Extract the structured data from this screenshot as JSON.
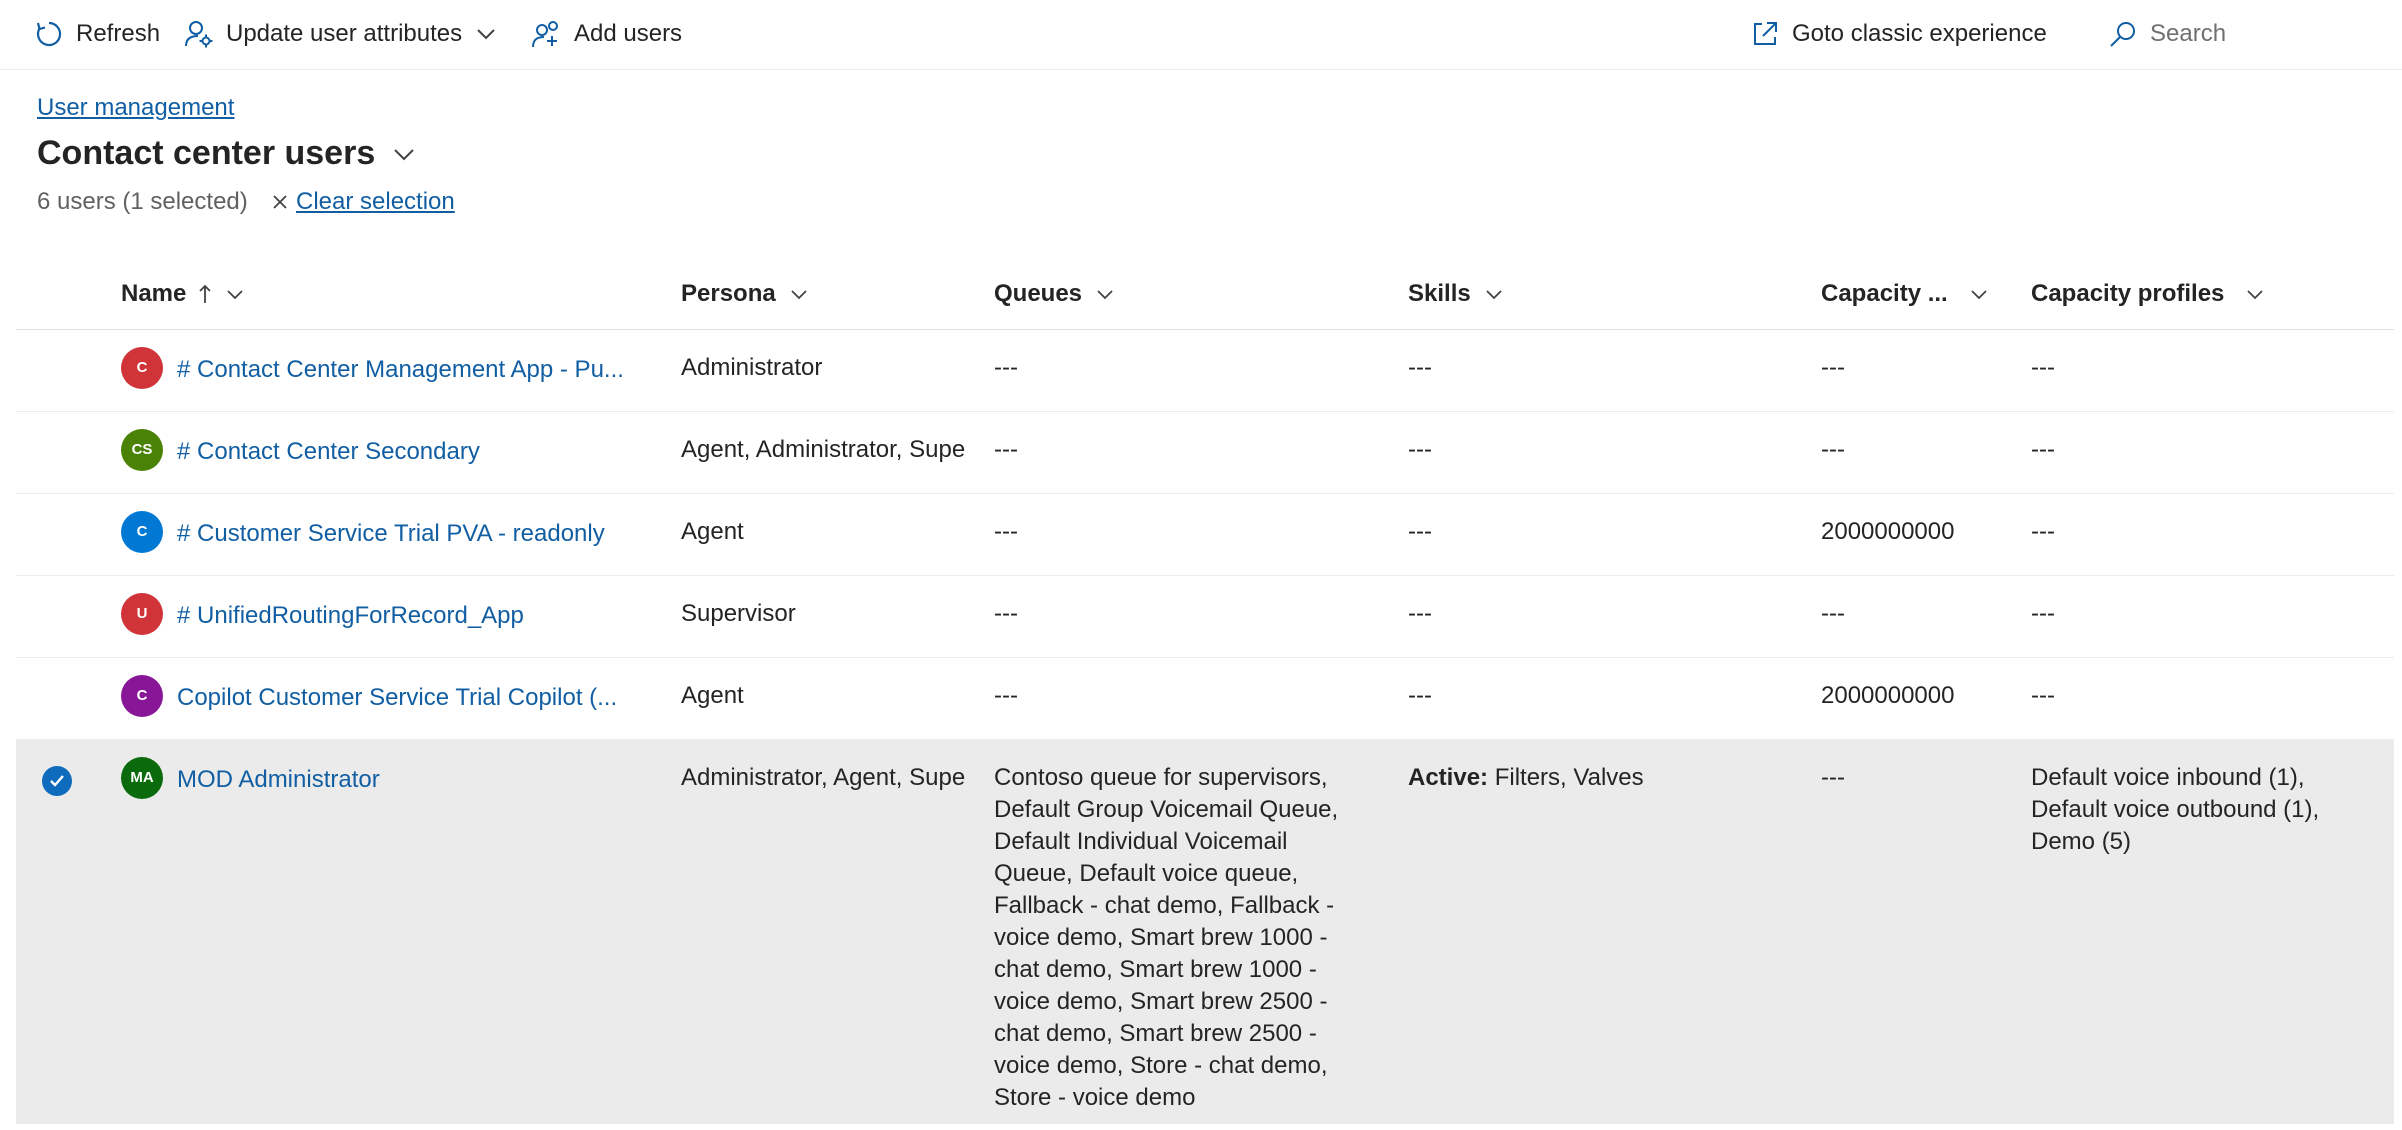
{
  "toolbar": {
    "refresh": "Refresh",
    "update_user_attributes": "Update user attributes",
    "add_users": "Add users",
    "goto_classic": "Goto classic experience",
    "search_placeholder": "Search"
  },
  "header": {
    "breadcrumb": "User management",
    "title": "Contact center users",
    "selection_status": "6 users (1 selected)",
    "clear_selection": "Clear selection"
  },
  "columns": {
    "name": "Name",
    "persona": "Persona",
    "queues": "Queues",
    "skills": "Skills",
    "capacity": "Capacity ...",
    "capacity_profiles": "Capacity profiles"
  },
  "rows": [
    {
      "initials": "C",
      "avatar_color": "#d13438",
      "name": "# Contact Center Management App - Pu...",
      "persona": "Administrator",
      "queues": "---",
      "skills": "---",
      "capacity": "---",
      "capacity_profiles": "---"
    },
    {
      "initials": "CS",
      "avatar_color": "#498205",
      "name": "# Contact Center Secondary",
      "persona": "Agent, Administrator, Supe",
      "queues": "---",
      "skills": "---",
      "capacity": "---",
      "capacity_profiles": "---"
    },
    {
      "initials": "C",
      "avatar_color": "#0078d4",
      "name": "# Customer Service Trial PVA - readonly",
      "persona": "Agent",
      "queues": "---",
      "skills": "---",
      "capacity": "2000000000",
      "capacity_profiles": "---"
    },
    {
      "initials": "U",
      "avatar_color": "#d13438",
      "name": "# UnifiedRoutingForRecord_App",
      "persona": "Supervisor",
      "queues": "---",
      "skills": "---",
      "capacity": "---",
      "capacity_profiles": "---"
    },
    {
      "initials": "C",
      "avatar_color": "#881798",
      "name": "Copilot Customer Service Trial Copilot (...",
      "persona": "Agent",
      "queues": "---",
      "skills": "---",
      "capacity": "2000000000",
      "capacity_profiles": "---"
    },
    {
      "initials": "MA",
      "avatar_color": "#0b6a0b",
      "name": "MOD Administrator",
      "persona": "Administrator, Agent, Supe",
      "queues": "Contoso queue for supervisors, Default Group Voicemail Queue, Default Individual Voicemail Queue, Default voice queue, Fallback - chat demo, Fallback - voice demo, Smart brew 1000 - chat demo, Smart brew 1000 - voice demo, Smart brew 2500 - chat demo, Smart brew 2500 - voice demo, Store - chat demo, Store - voice demo",
      "skills_label": "Active:",
      "skills": "Filters, Valves",
      "capacity": "---",
      "capacity_profiles": "Default voice inbound (1), Default voice outbound (1), Demo (5)",
      "selected": true
    }
  ]
}
